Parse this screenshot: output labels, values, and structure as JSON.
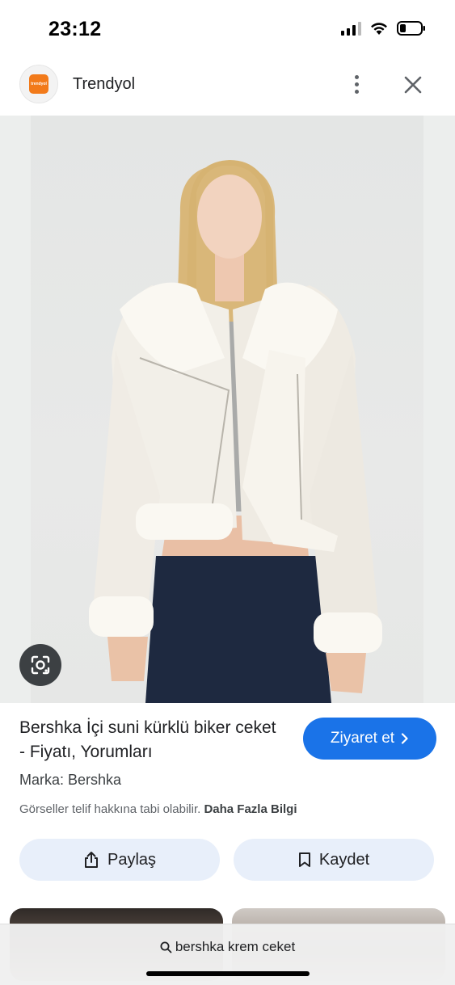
{
  "status_bar": {
    "time": "23:12",
    "icons": [
      "cellular-signal-icon",
      "wifi-icon",
      "battery-icon"
    ]
  },
  "header": {
    "site_name": "Trendyol",
    "logo_text": "trendyol",
    "more_icon": "more-vert-icon",
    "close_icon": "close-icon"
  },
  "image": {
    "lens_icon": "google-lens-icon"
  },
  "product": {
    "title": "Bershka İçi suni kürklü biker ceket - Fiyatı, Yorumları",
    "brand": "Marka: Bershka",
    "copyright_text": "Görseller telif hakkına tabi olabilir.",
    "learn_more": "Daha Fazla Bilgi"
  },
  "visit_button": {
    "label": "Ziyaret et",
    "icon": "chevron-right-icon",
    "color": "#1a73e8"
  },
  "actions": {
    "share_label": "Paylaş",
    "save_label": "Kaydet"
  },
  "bottom_bar": {
    "search_query": "bershka krem ceket"
  }
}
